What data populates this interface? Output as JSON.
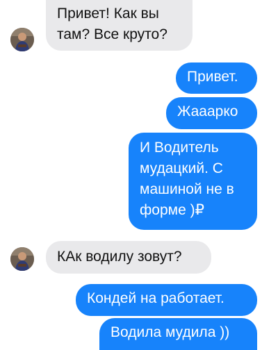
{
  "conversation": {
    "messages": [
      {
        "sender": "contact",
        "text": "Привет! Как вы\nтам? Все круто?"
      },
      {
        "sender": "me",
        "text": "Привет."
      },
      {
        "sender": "me",
        "text": "Жааарко"
      },
      {
        "sender": "me",
        "text": "И Водитель\nмудацкий. С\nмашиной не в\nформе )₽"
      },
      {
        "sender": "contact",
        "text": "КАк водилу зовут?"
      },
      {
        "sender": "me",
        "text": "Кондей на работает."
      },
      {
        "sender": "me",
        "text": "Водила мудила ))"
      }
    ]
  },
  "colors": {
    "outgoing_bubble": "#1783fb",
    "incoming_bubble": "#e9e9eb",
    "outgoing_text": "#ffffff",
    "incoming_text": "#111111"
  },
  "icons": {
    "avatar": "contact-avatar-photo"
  }
}
